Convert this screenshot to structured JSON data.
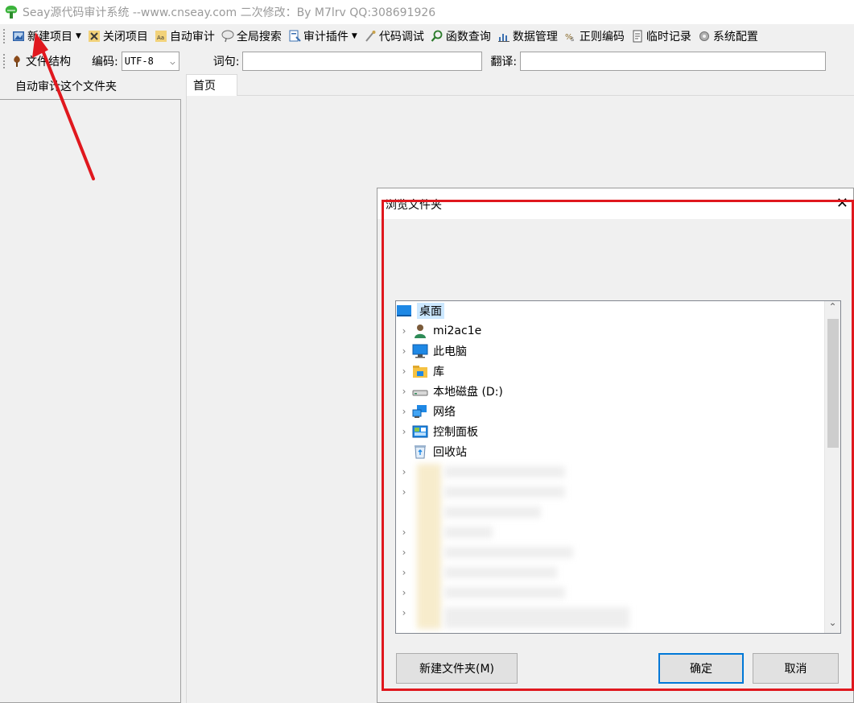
{
  "window": {
    "title": "Seay源代码审计系统  --www.cnseay.com     二次修改：By M7lrv  QQ:308691926"
  },
  "toolbar": {
    "items": [
      {
        "label": "新建项目",
        "icon": "new-project-icon",
        "dropdown": true
      },
      {
        "label": "关闭项目",
        "icon": "close-project-icon"
      },
      {
        "label": "自动审计",
        "icon": "auto-audit-icon"
      },
      {
        "label": "全局搜索",
        "icon": "global-search-icon"
      },
      {
        "label": "审计插件",
        "icon": "plugin-icon",
        "dropdown": true
      },
      {
        "label": "代码调试",
        "icon": "debug-icon"
      },
      {
        "label": "函数查询",
        "icon": "function-query-icon"
      },
      {
        "label": "数据管理",
        "icon": "data-manage-icon"
      },
      {
        "label": "正则编码",
        "icon": "regex-encode-icon"
      },
      {
        "label": "临时记录",
        "icon": "temp-record-icon"
      },
      {
        "label": "系统配置",
        "icon": "settings-icon"
      }
    ]
  },
  "toolbar2": {
    "file_structure": "文件结构",
    "encoding_label": "编码:",
    "encoding_value": "UTF-8",
    "word_label": "词句:",
    "translate_label": "翻译:"
  },
  "left_panel": {
    "header": "自动审计这个文件夹"
  },
  "tabs": [
    {
      "label": "首页"
    }
  ],
  "dialog": {
    "title": "浏览文件夹",
    "close_glyph": "✕",
    "tree": [
      {
        "label": "桌面",
        "icon": "desktop-icon",
        "expandable": false,
        "selected": true,
        "indent": 0
      },
      {
        "label": "mi2ac1e",
        "icon": "user-icon",
        "expandable": true,
        "indent": 1
      },
      {
        "label": "此电脑",
        "icon": "computer-icon",
        "expandable": true,
        "indent": 1
      },
      {
        "label": "库",
        "icon": "library-icon",
        "expandable": true,
        "indent": 1
      },
      {
        "label": "本地磁盘 (D:)",
        "icon": "drive-icon",
        "expandable": true,
        "indent": 1
      },
      {
        "label": "网络",
        "icon": "network-icon",
        "expandable": true,
        "indent": 1
      },
      {
        "label": "控制面板",
        "icon": "control-panel-icon",
        "expandable": true,
        "indent": 1
      },
      {
        "label": "回收站",
        "icon": "recycle-bin-icon",
        "expandable": false,
        "indent": 1
      }
    ],
    "new_folder_button": "新建文件夹(M)",
    "ok_button": "确定",
    "cancel_button": "取消"
  },
  "colors": {
    "annotation_red": "#e0181e",
    "selection": "#cce8ff",
    "primary_border": "#0078d7"
  }
}
